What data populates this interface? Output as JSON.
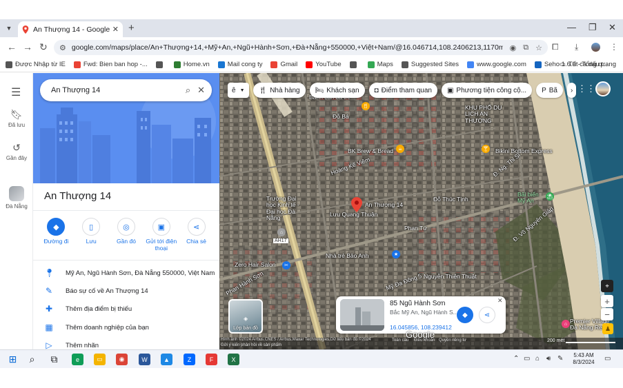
{
  "browser": {
    "tab_title": "An Thượng 14 - Google Maps",
    "url": "google.com/maps/place/An+Thượng+14,+Mỹ+An,+Ngũ+Hành+Sơn,+Đà+Nẵng+550000,+Việt+Nam/@16.046714,108.2406213,1170m/data=!3m1!..."
  },
  "bookmarks": [
    {
      "label": "Được Nhập từ IE",
      "icon": "folder-icon",
      "color": "#555555"
    },
    {
      "label": "Fwd: Bien ban hop -...",
      "icon": "gmail-icon",
      "color": "#ea4335"
    },
    {
      "label": "",
      "icon": "globe-icon",
      "color": "#555555"
    },
    {
      "label": "Home.vn",
      "icon": "home-icon",
      "color": "#2e7d32"
    },
    {
      "label": "Mail cong ty",
      "icon": "mail-icon",
      "color": "#1976d2"
    },
    {
      "label": "Gmail",
      "icon": "gmail-icon",
      "color": "#ea4335"
    },
    {
      "label": "YouTube",
      "icon": "youtube-icon",
      "color": "#ff0000"
    },
    {
      "label": "",
      "icon": "globe-icon",
      "color": "#555555"
    },
    {
      "label": "Maps",
      "icon": "maps-icon",
      "color": "#34a853"
    },
    {
      "label": "Suggested Sites",
      "icon": "search-icon",
      "color": "#555555"
    },
    {
      "label": "www.google.com",
      "icon": "google-icon",
      "color": "#4285f4"
    },
    {
      "label": "Seho 1.6.0 - Tổng q...",
      "icon": "seho-icon",
      "color": "#1565c0"
    }
  ],
  "bookmarks_all": "Tất cả dấu trang",
  "rail": {
    "saved": "Đã lưu",
    "recent": "Gần đây",
    "recent_place": "Đà Nẵng"
  },
  "panel": {
    "search_value": "An Thượng 14",
    "place_title": "An Thượng 14",
    "actions": [
      {
        "label": "Đường đi",
        "icon": "directions-icon"
      },
      {
        "label": "Lưu",
        "icon": "bookmark-icon"
      },
      {
        "label": "Gần đó",
        "icon": "nearby-icon"
      },
      {
        "label": "Gửi tới điện thoại",
        "icon": "send-to-phone-icon"
      },
      {
        "label": "Chia sẻ",
        "icon": "share-icon"
      }
    ],
    "info": [
      {
        "text": "Mỹ An, Ngũ Hành Sơn, Đà Nẵng 550000, Việt Nam",
        "icon": "location-pin-icon"
      },
      {
        "text": "Báo sự cố về An Thượng 14",
        "icon": "edit-pencil-icon"
      },
      {
        "text": "Thêm địa điểm bị thiếu",
        "icon": "add-place-icon"
      },
      {
        "text": "Thêm doanh nghiệp của bạn",
        "icon": "add-business-icon"
      },
      {
        "text": "Thêm nhãn",
        "icon": "label-icon"
      }
    ]
  },
  "map": {
    "lang_chip": "ê",
    "chips": [
      {
        "label": "Nhà hàng",
        "icon": "restaurant-icon"
      },
      {
        "label": "Khách sạn",
        "icon": "hotel-icon"
      },
      {
        "label": "Điểm tham quan",
        "icon": "camera-icon"
      },
      {
        "label": "Phương tiện công cộ...",
        "icon": "transit-icon"
      },
      {
        "label": "Bã",
        "icon": "parking-icon"
      }
    ],
    "labels": [
      {
        "text": "Đỗ Bá",
        "class": "lbl-doba"
      },
      {
        "text": "Bánh căn ba tre",
        "class": "lbl-banhcan"
      },
      {
        "text": "KHU PHỐ DU LỊCH AN THƯỢNG",
        "class": "lbl-khupho"
      },
      {
        "text": "BK Brew & Bread",
        "class": "lbl-bk"
      },
      {
        "text": "Bikini Bottom Express",
        "class": "lbl-bikini"
      },
      {
        "text": "Hoàng Kế Viêm",
        "class": "lbl-hkv"
      },
      {
        "text": "Đ. Ng. Thi Sĩ",
        "class": "lbl-ngthisi"
      },
      {
        "text": "Trường Đại học Kinh tế - Đại học Đà Nẵng",
        "class": "lbl-truong"
      },
      {
        "text": "An Thượng 14",
        "class": "lbl-anthuong"
      },
      {
        "text": "Bãi biển Mỹ An",
        "class": "lbl-baibien"
      },
      {
        "text": "Đỗ Thúc Tịnh",
        "class": "lbl-dtt"
      },
      {
        "text": "Lưu Quang Thuận",
        "class": "lbl-lqt"
      },
      {
        "text": "Phan Tứ",
        "class": "lbl-phantu"
      },
      {
        "text": "Nhà trẻ Bảo Anh",
        "class": "lbl-nhatre"
      },
      {
        "text": "Zero Hair Salon",
        "class": "lbl-zero"
      },
      {
        "text": "Phan Hành Sơn",
        "class": "lbl-phs"
      },
      {
        "text": "Mỹ Đa Đông 5",
        "class": "lbl-mdd"
      },
      {
        "text": "Nguyễn Thiện Thuật",
        "class": "lbl-ntt"
      },
      {
        "text": "Premier Village Đà Nẵng Resort",
        "class": "lbl-premier"
      },
      {
        "text": "Đ. Võ Nguyên Giáp",
        "class": "lbl-vng"
      },
      {
        "text": "AH17",
        "class": "lbl-ah17"
      }
    ],
    "layers_label": "Lớp bản đồ",
    "card": {
      "title": "85 Ngũ Hành Sơn",
      "subtitle": "Bắc Mỹ An, Ngũ Hành S...",
      "coords": "16.045856, 108.239412"
    },
    "google_logo": "Google",
    "attribution": "Hình ảnh ©2024 Airbus,CNES / Airbus,Maxar Technologies,Dữ liệu bản đồ ©2024",
    "attribution2": "Gửi ý kiến phản hồi về sản phẩm",
    "footer_links": [
      "Toàn cầu",
      "Điều khoản",
      "Quyền riêng tư"
    ],
    "scale": "200 mét"
  },
  "taskbar": {
    "time": "5:43 AM",
    "date": "8/3/2024",
    "apps": [
      {
        "icon": "windows-icon",
        "color": "#0b6bd6"
      },
      {
        "icon": "search-icon",
        "color": "#202124"
      },
      {
        "icon": "task-view-icon",
        "color": "#202124"
      },
      {
        "icon": "edge-icon",
        "color": "#0f9d58"
      },
      {
        "icon": "file-explorer-icon",
        "color": "#f4b400"
      },
      {
        "icon": "chrome-icon",
        "color": "#db4437"
      },
      {
        "icon": "word-icon",
        "color": "#2b579a"
      },
      {
        "icon": "photos-icon",
        "color": "#1e88e5"
      },
      {
        "icon": "zalo-icon",
        "color": "#0068ff"
      },
      {
        "icon": "foxit-icon",
        "color": "#e53935"
      },
      {
        "icon": "excel-icon",
        "color": "#217346"
      }
    ]
  }
}
